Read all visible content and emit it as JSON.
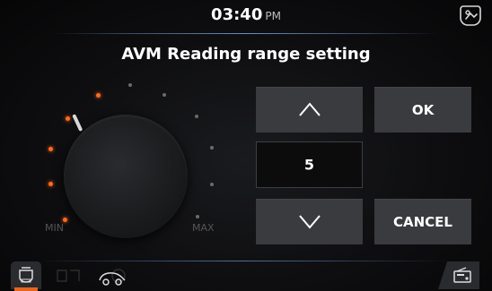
{
  "header": {
    "time": "03:40",
    "ampm": "PM",
    "user_icon": "driver-profile-icon"
  },
  "title": "AVM Reading range setting",
  "dial": {
    "min_label": "MIN",
    "max_label": "MAX",
    "level": 5,
    "steps": 10,
    "active_color": "#ff6a1f",
    "inactive_color": "#6b6b6b"
  },
  "controls": {
    "up_icon": "chevron-up-icon",
    "down_icon": "chevron-down-icon",
    "value": "5",
    "ok_label": "OK",
    "cancel_label": "CANCEL"
  },
  "footer": {
    "left_icon": "auto-nmh-icon",
    "center_icon": "car-icon",
    "right_icon": "radio-icon",
    "accent_color": "#e8651e"
  }
}
